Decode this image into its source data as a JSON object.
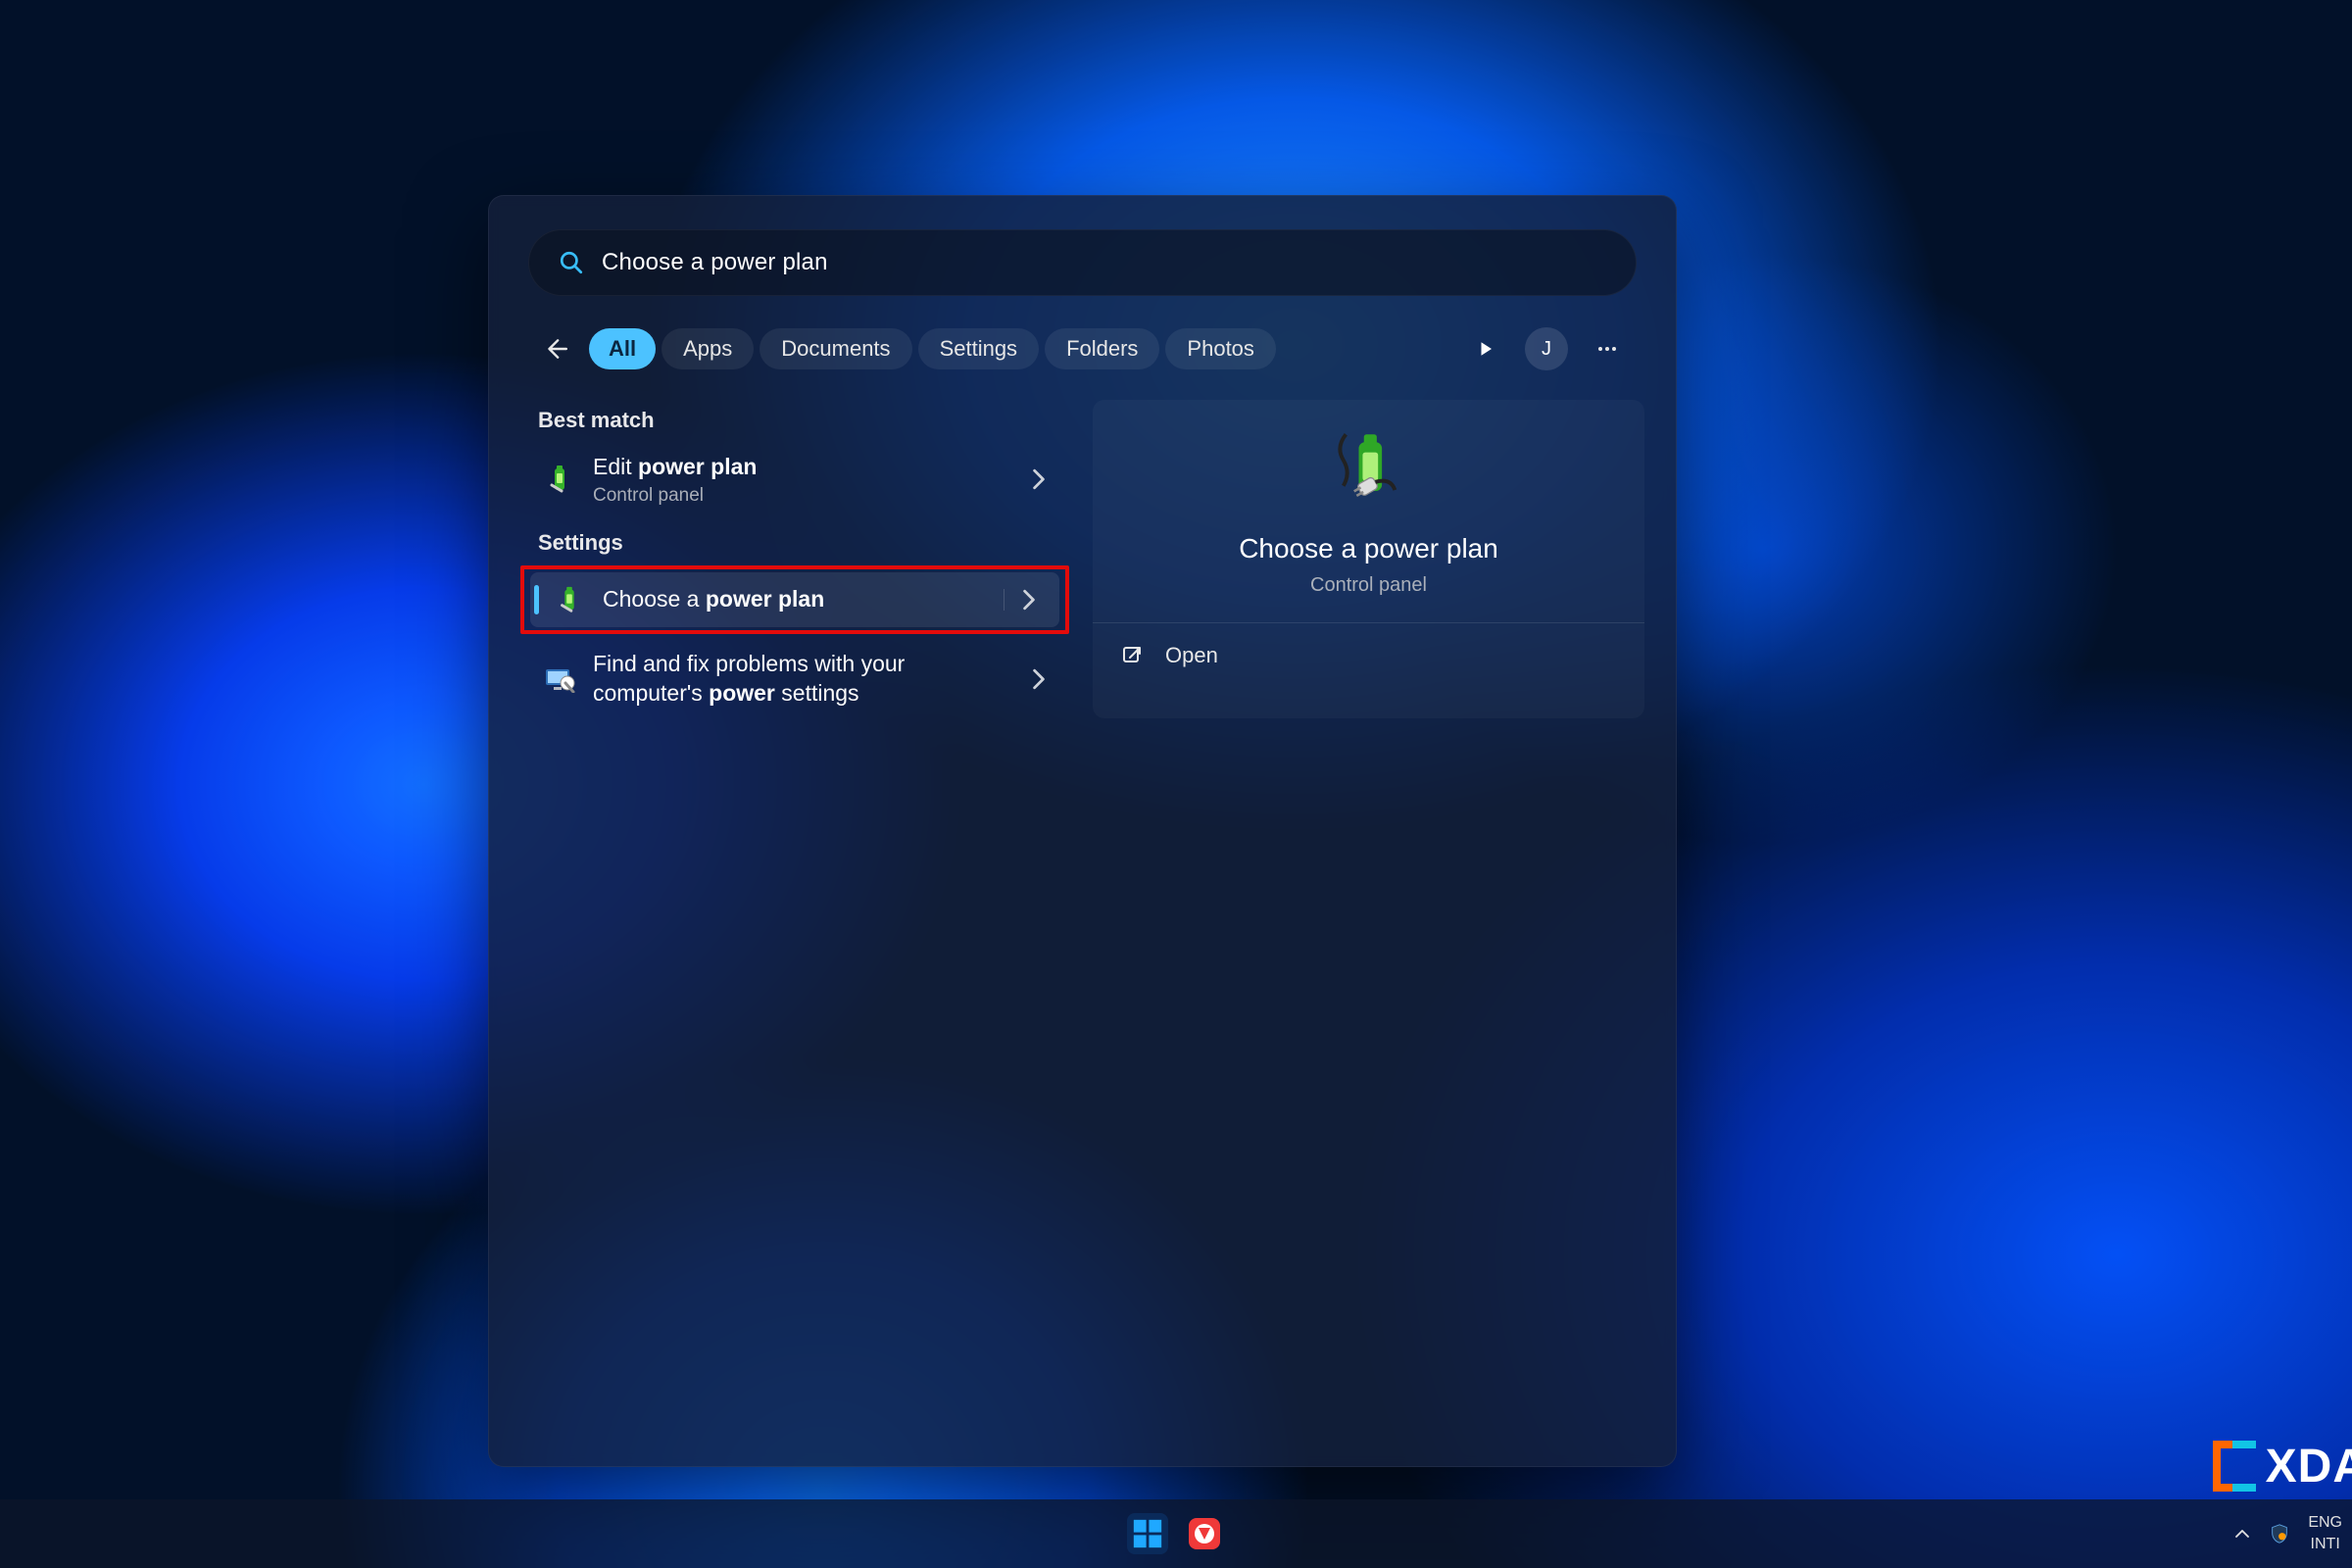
{
  "search": {
    "query": "Choose a power plan"
  },
  "filters": {
    "all": "All",
    "apps": "Apps",
    "documents": "Documents",
    "settings": "Settings",
    "folders": "Folders",
    "photos": "Photos"
  },
  "user": {
    "initial": "J"
  },
  "results": {
    "best_match_header": "Best match",
    "best_match": {
      "title_prefix": "Edit ",
      "title_bold": "power plan",
      "subtitle": "Control panel"
    },
    "settings_header": "Settings",
    "settings_items": [
      {
        "title_prefix": "Choose a ",
        "title_bold": "power plan",
        "title_suffix": "",
        "selected": true,
        "highlighted": true
      },
      {
        "title_prefix": "Find and fix problems with your computer's ",
        "title_bold": "power",
        "title_suffix": " settings",
        "selected": false,
        "highlighted": false
      }
    ]
  },
  "preview": {
    "title": "Choose a power plan",
    "subtitle": "Control panel",
    "actions": {
      "open": "Open"
    }
  },
  "taskbar": {
    "start": "start",
    "app_vivaldi": "vivaldi"
  },
  "tray": {
    "lang1": "ENG",
    "lang2": "INTI"
  },
  "watermark": "XDA"
}
